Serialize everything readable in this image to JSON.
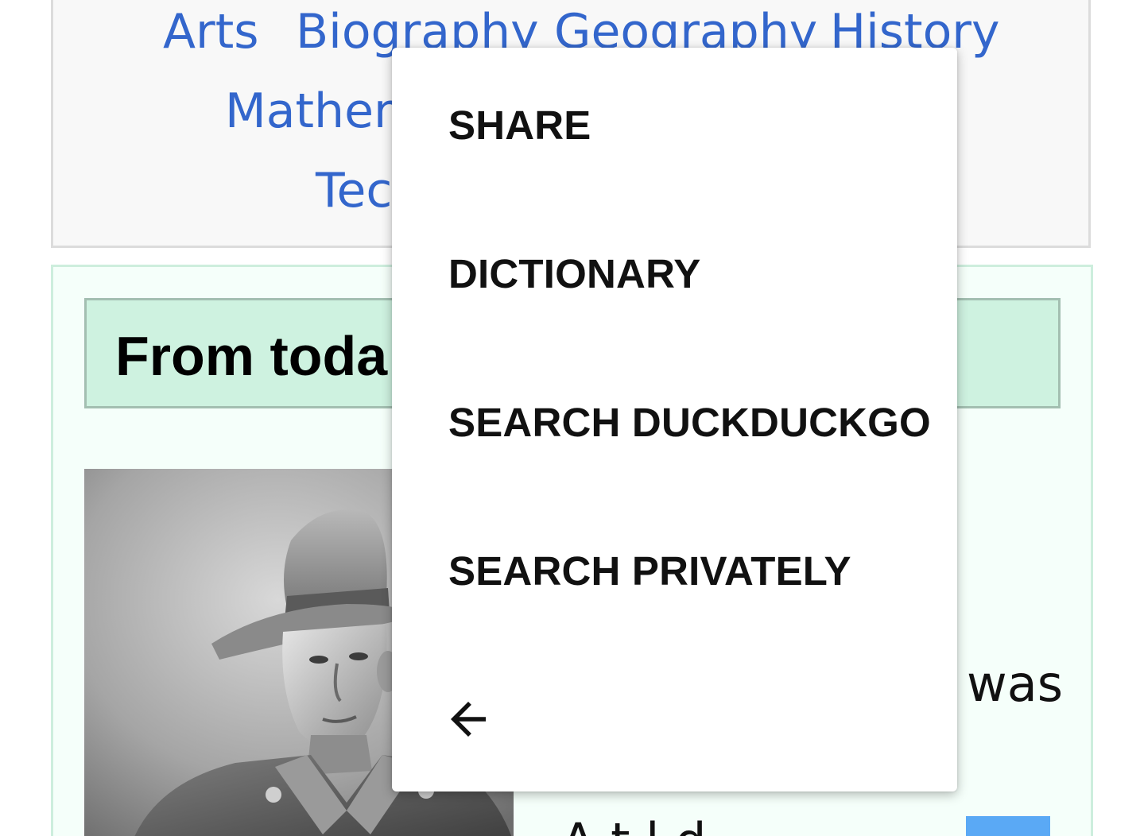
{
  "topics": {
    "links": [
      "Arts",
      "Biography",
      "Geography",
      "History",
      "Mathem",
      "Tec"
    ]
  },
  "featured": {
    "title": "From toda"
  },
  "article": {
    "text_was": "was",
    "text_bottom": "A    t    l    d"
  },
  "context_menu": {
    "items": [
      "SHARE",
      "DICTIONARY",
      "SEARCH DUCKDUCKGO",
      "SEARCH PRIVATELY"
    ],
    "back_icon": "arrow-left-icon"
  },
  "colors": {
    "link": "#3366cc",
    "featured_bg": "#f5fffa",
    "featured_header_bg": "#cef2e0",
    "selection": "#5aa9f5"
  }
}
